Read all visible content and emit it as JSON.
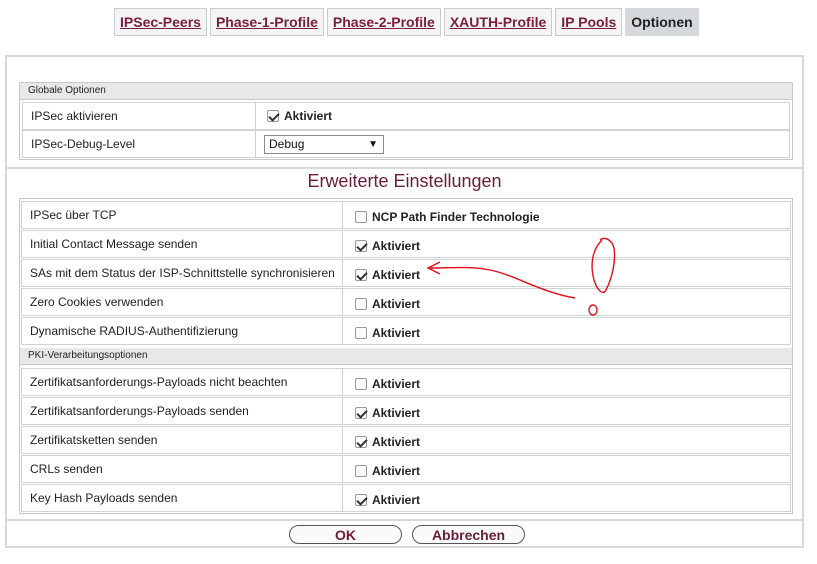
{
  "tabs": [
    {
      "label": "IPSec-Peers",
      "active": false
    },
    {
      "label": "Phase-1-Profile",
      "active": false
    },
    {
      "label": "Phase-2-Profile",
      "active": false
    },
    {
      "label": "XAUTH-Profile",
      "active": false
    },
    {
      "label": "IP Pools",
      "active": false
    },
    {
      "label": "Optionen",
      "active": true
    }
  ],
  "global": {
    "title": "Globale Optionen",
    "ipsec_label": "IPSec aktivieren",
    "ipsec_value": "Aktiviert",
    "ipsec_checked": true,
    "debug_label": "IPSec-Debug-Level",
    "debug_value": "Debug"
  },
  "advanced": {
    "title": "Erweiterte Einstellungen",
    "rows": [
      {
        "label": "IPSec über TCP",
        "value": "NCP Path Finder Technologie",
        "checked": false
      },
      {
        "label": "Initial Contact Message senden",
        "value": "Aktiviert",
        "checked": true
      },
      {
        "label": "SAs mit dem Status der ISP-Schnittstelle synchronisieren",
        "value": "Aktiviert",
        "checked": true
      },
      {
        "label": "Zero Cookies verwenden",
        "value": "Aktiviert",
        "checked": false
      },
      {
        "label": "Dynamische RADIUS-Authentifizierung",
        "value": "Aktiviert",
        "checked": false
      }
    ],
    "pki_title": "PKI-Verarbeitungsoptionen",
    "pki_rows": [
      {
        "label": "Zertifikatsanforderungs-Payloads nicht beachten",
        "value": "Aktiviert",
        "checked": false
      },
      {
        "label": "Zertifikatsanforderungs-Payloads senden",
        "value": "Aktiviert",
        "checked": true
      },
      {
        "label": "Zertifikatsketten senden",
        "value": "Aktiviert",
        "checked": true
      },
      {
        "label": "CRLs senden",
        "value": "Aktiviert",
        "checked": false
      },
      {
        "label": "Key Hash Payloads senden",
        "value": "Aktiviert",
        "checked": true
      }
    ]
  },
  "buttons": {
    "ok": "OK",
    "cancel": "Abbrechen"
  },
  "colors": {
    "accent": "#6b1d36",
    "annotation": "#e0101a"
  }
}
